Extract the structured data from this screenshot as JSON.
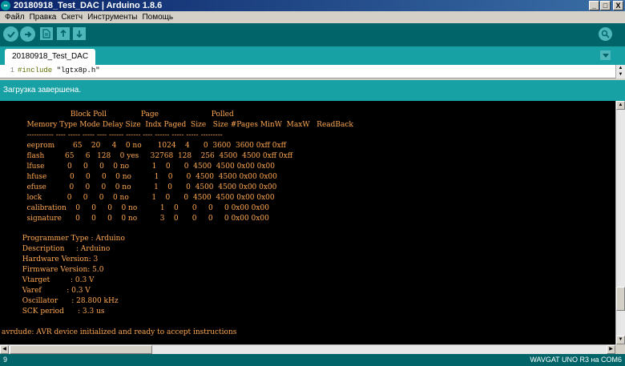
{
  "window": {
    "title": "20180918_Test_DAC | Arduino 1.8.6",
    "app_icon": "arduino-infinity-icon",
    "minimize": "_",
    "maximize": "□",
    "close": "X"
  },
  "menu": [
    "Файл",
    "Правка",
    "Скетч",
    "Инструменты",
    "Помощь"
  ],
  "toolbar": {
    "buttons": [
      "verify-check-icon",
      "upload-arrow-icon",
      "new-file-icon",
      "open-up-arrow-icon",
      "save-down-arrow-icon"
    ],
    "serial_monitor": "serial-monitor-magnifier-icon"
  },
  "tabs": {
    "active": "20180918_Test_DAC",
    "menu_icon": "tab-menu-triangle-icon"
  },
  "editor": {
    "line_number": "1",
    "directive": "#include",
    "argument": " \"lgtx8p.h\""
  },
  "status": {
    "message": "Загрузка завершена."
  },
  "console": {
    "lines": [
      "                              Block Poll               Page                       Polled",
      "           Memory Type Mode Delay Size  Indx Paged  Size   Size #Pages MinW  MaxW   ReadBack",
      "           ----------- ---- ----- ----- ---- ------ ------ ---- ------ ----- ----- ---------",
      "           eeprom        65    20     4    0 no       1024    4      0  3600  3600 0xff 0xff",
      "           flash         65     6   128    0 yes     32768  128    256  4500  4500 0xff 0xff",
      "           lfuse          0     0     0    0 no          1    0      0  4500  4500 0x00 0x00",
      "           hfuse          0     0     0    0 no          1    0      0  4500  4500 0x00 0x00",
      "           efuse          0     0     0    0 no          1    0      0  4500  4500 0x00 0x00",
      "           lock           0     0     0    0 no          1    0      0  4500  4500 0x00 0x00",
      "           calibration    0     0     0    0 no          1    0      0     0     0 0x00 0x00",
      "           signature      0     0     0    0 no          3    0      0     0     0 0x00 0x00",
      "",
      "         Programmer Type : Arduino",
      "         Description     : Arduino",
      "         Hardware Version: 3",
      "         Firmware Version: 5.0",
      "         Vtarget         : 0.3 V",
      "         Varef           : 0.3 V",
      "         Oscillator      : 28.800 kHz",
      "         SCK period      : 3.3 us",
      "",
      "avrdude: AVR device initialized and ready to accept instructions"
    ],
    "text_color": "#ffa852"
  },
  "footer": {
    "line": "9",
    "board": "WAVGAT UNO R3 на COM6"
  },
  "colors": {
    "toolbar": "#006468",
    "accent": "#17a1a5",
    "button": "#4db7bb"
  }
}
